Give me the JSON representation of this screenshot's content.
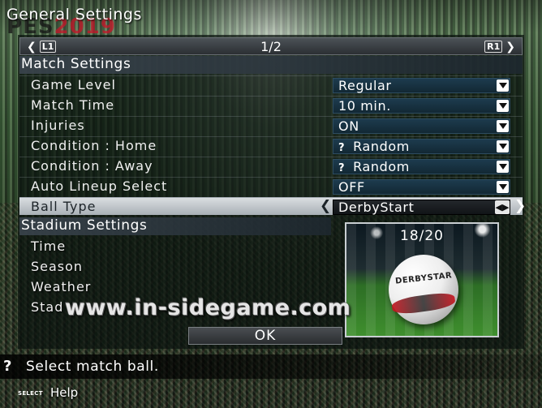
{
  "header": {
    "title": "General Settings",
    "game_logo": "PES2019",
    "game_logo_main": "PES",
    "game_logo_year": "2019"
  },
  "pager": {
    "left_button": "L1",
    "page": "1/2",
    "right_button": "R1"
  },
  "match_settings": {
    "heading": "Match Settings",
    "rows": [
      {
        "label": "Game Level",
        "value": "Regular"
      },
      {
        "label": "Match Time",
        "value": "10 min."
      },
      {
        "label": "Injuries",
        "value": "ON"
      },
      {
        "label": "Condition : Home",
        "value": "Random",
        "prefix": "?"
      },
      {
        "label": "Condition : Away",
        "value": "Random",
        "prefix": "?"
      },
      {
        "label": "Auto Lineup Select",
        "value": "OFF"
      },
      {
        "label": "Ball Type",
        "value": "DerbyStart",
        "selected": true
      }
    ]
  },
  "stadium_settings": {
    "heading": "Stadium Settings",
    "rows": [
      {
        "label": "Time"
      },
      {
        "label": "Season"
      },
      {
        "label": "Weather"
      },
      {
        "label": "Stad"
      }
    ]
  },
  "ball_preview": {
    "counter": "18/20",
    "brand": "DERBYSTAR"
  },
  "ok_button": "OK",
  "watermark": "www.in-sidegame.com",
  "help": {
    "icon": "?",
    "text": "Select match ball."
  },
  "footer": {
    "button": "SELECT",
    "label": "Help"
  }
}
